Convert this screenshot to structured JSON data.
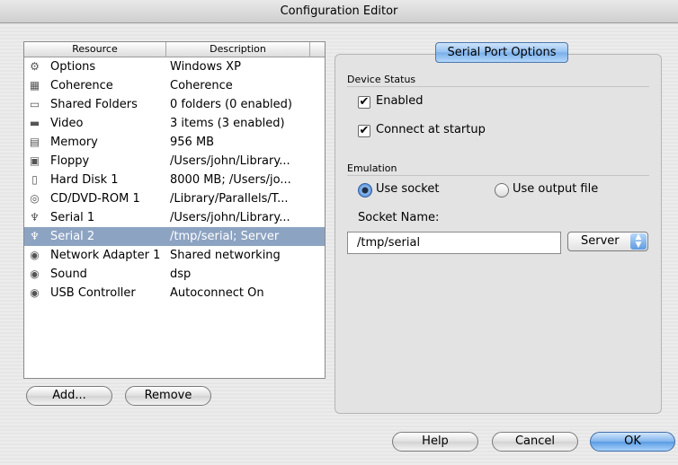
{
  "window": {
    "title": "Configuration Editor"
  },
  "table": {
    "columns": [
      "Resource",
      "Description"
    ],
    "rows": [
      {
        "icon": "options-icon",
        "glyph": "⚙",
        "name": "Options",
        "desc": "Windows XP",
        "selected": false
      },
      {
        "icon": "coherence-icon",
        "glyph": "▦",
        "name": "Coherence",
        "desc": "Coherence",
        "selected": false
      },
      {
        "icon": "shared-folder-icon",
        "glyph": "▭",
        "name": "Shared Folders",
        "desc": "0 folders (0 enabled)",
        "selected": false
      },
      {
        "icon": "video-icon",
        "glyph": "▬",
        "name": "Video",
        "desc": "3 items (3 enabled)",
        "selected": false
      },
      {
        "icon": "memory-icon",
        "glyph": "▤",
        "name": "Memory",
        "desc": "956 MB",
        "selected": false
      },
      {
        "icon": "floppy-icon",
        "glyph": "▣",
        "name": "Floppy",
        "desc": "/Users/john/Library...",
        "selected": false
      },
      {
        "icon": "hard-disk-icon",
        "glyph": "▯",
        "name": "Hard Disk 1",
        "desc": "8000 MB; /Users/jo...",
        "selected": false
      },
      {
        "icon": "cd-dvd-icon",
        "glyph": "◎",
        "name": "CD/DVD-ROM 1",
        "desc": "/Library/Parallels/T...",
        "selected": false
      },
      {
        "icon": "serial-port-icon",
        "glyph": "♆",
        "name": "Serial 1",
        "desc": "/Users/john/Library...",
        "selected": false
      },
      {
        "icon": "serial-port-icon",
        "glyph": "♆",
        "name": "Serial 2",
        "desc": "/tmp/serial; Server",
        "selected": true
      },
      {
        "icon": "network-adapter-icon",
        "glyph": "◉",
        "name": "Network Adapter 1",
        "desc": "Shared networking",
        "selected": false
      },
      {
        "icon": "sound-icon",
        "glyph": "◉",
        "name": "Sound",
        "desc": "dsp",
        "selected": false
      },
      {
        "icon": "usb-icon",
        "glyph": "◉",
        "name": "USB Controller",
        "desc": "Autoconnect On",
        "selected": false
      }
    ]
  },
  "buttons": {
    "add": "Add...",
    "remove": "Remove",
    "help": "Help",
    "cancel": "Cancel",
    "ok": "OK"
  },
  "panel": {
    "tab_label": "Serial Port Options",
    "device_status": {
      "heading": "Device Status",
      "enabled_label": "Enabled",
      "enabled": true,
      "connect_label": "Connect at startup",
      "connect": true
    },
    "emulation": {
      "heading": "Emulation",
      "use_socket_label": "Use socket",
      "use_output_file_label": "Use output file",
      "selected": "Use socket",
      "socket_name_label": "Socket Name:",
      "socket_name_value": "/tmp/serial",
      "mode_value": "Server"
    }
  },
  "colors": {
    "selection": "#8da3c2",
    "accent": "#5a9be4"
  }
}
